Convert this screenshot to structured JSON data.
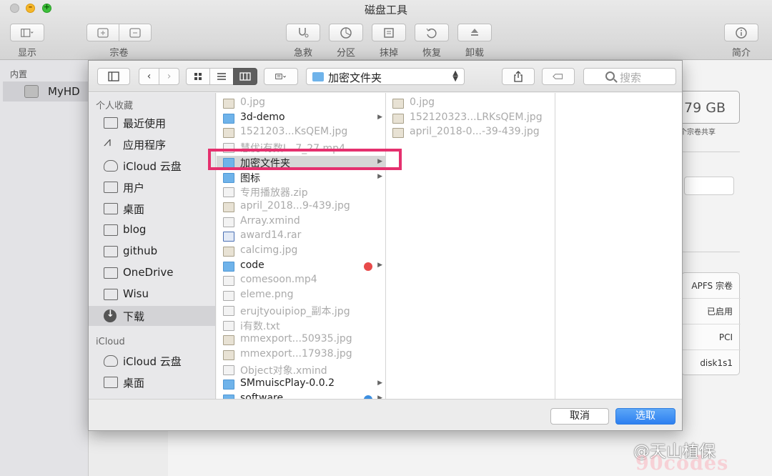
{
  "window": {
    "title": "磁盘工具",
    "toolbar": {
      "view_label": "显示",
      "volume_label": "宗卷",
      "firstaid_label": "急救",
      "partition_label": "分区",
      "erase_label": "抹掉",
      "restore_label": "恢复",
      "unmount_label": "卸载",
      "info_label": "简介"
    },
    "sidebar": {
      "section": "内置",
      "items": [
        {
          "label": "MyHD"
        }
      ]
    },
    "content": {
      "capacity": "79 GB",
      "capacity_sub": "个宗卷共享",
      "info": [
        "APFS 宗卷",
        "已启用",
        "PCI",
        "disk1s1"
      ]
    }
  },
  "dialog": {
    "path": "加密文件夹",
    "search_placeholder": "搜索",
    "sidebar": {
      "favorites_header": "个人收藏",
      "favorites": [
        {
          "label": "最近使用",
          "icon": "recents-icon"
        },
        {
          "label": "应用程序",
          "icon": "applications-icon"
        },
        {
          "label": "iCloud 云盘",
          "icon": "cloud-icon"
        },
        {
          "label": "用户",
          "icon": "folder-icon"
        },
        {
          "label": "桌面",
          "icon": "desktop-icon"
        },
        {
          "label": "blog",
          "icon": "folder-icon"
        },
        {
          "label": "github",
          "icon": "folder-icon"
        },
        {
          "label": "OneDrive",
          "icon": "folder-icon"
        },
        {
          "label": "Wisu",
          "icon": "folder-icon"
        },
        {
          "label": "下载",
          "icon": "downloads-icon",
          "selected": true
        }
      ],
      "icloud_header": "iCloud",
      "icloud": [
        {
          "label": "iCloud 云盘",
          "icon": "cloud-icon"
        },
        {
          "label": "桌面",
          "icon": "desktop-icon"
        }
      ]
    },
    "column1": [
      {
        "name": "0.jpg",
        "kind": "img"
      },
      {
        "name": "3d-demo",
        "kind": "folder",
        "arrow": true
      },
      {
        "name": "1521203...KsQEM.jpg",
        "kind": "img"
      },
      {
        "name": "慧优i有数I...7_27.mp4",
        "kind": "file"
      },
      {
        "name": "加密文件夹",
        "kind": "folder",
        "arrow": true,
        "selected": true
      },
      {
        "name": "图标",
        "kind": "folder",
        "arrow": true
      },
      {
        "name": "专用播放器.zip",
        "kind": "file"
      },
      {
        "name": "april_2018...9-439.jpg",
        "kind": "img"
      },
      {
        "name": "Array.xmind",
        "kind": "file"
      },
      {
        "name": "award14.rar",
        "kind": "rar"
      },
      {
        "name": "calcimg.jpg",
        "kind": "img"
      },
      {
        "name": "code",
        "kind": "folder",
        "arrow": true,
        "tag": "#e84a4a"
      },
      {
        "name": "comesoon.mp4",
        "kind": "file"
      },
      {
        "name": "eleme.png",
        "kind": "file"
      },
      {
        "name": "erujtyouipiop_副本.jpg",
        "kind": "file"
      },
      {
        "name": "i有数.txt",
        "kind": "file"
      },
      {
        "name": "mmexport...50935.jpg",
        "kind": "img"
      },
      {
        "name": "mmexport...17938.jpg",
        "kind": "img"
      },
      {
        "name": "Object对象.xmind",
        "kind": "file"
      },
      {
        "name": "SMmuiscPlay-0.0.2",
        "kind": "folder",
        "arrow": true
      },
      {
        "name": "software",
        "kind": "folder",
        "arrow": true,
        "tag": "#3d8fe0"
      }
    ],
    "column2": [
      {
        "name": "0.jpg",
        "kind": "img"
      },
      {
        "name": "152120323...LRKsQEM.jpg",
        "kind": "img"
      },
      {
        "name": "april_2018-0...-39-439.jpg",
        "kind": "img"
      }
    ],
    "cancel_label": "取消",
    "choose_label": "选取"
  },
  "watermark": {
    "line1": "@天山植保",
    "line2": "90codes"
  }
}
